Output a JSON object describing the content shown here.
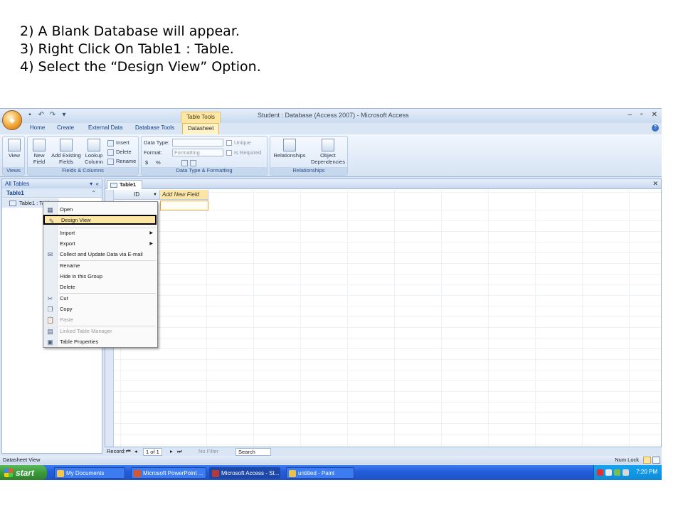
{
  "instructions": [
    "2) A Blank Database will appear.",
    "3) Right Click On Table1 : Table.",
    "4) Select the “Design View” Option."
  ],
  "window": {
    "title": "Student : Database (Access 2007) - Microsoft Access",
    "contextual_tab_group": "Table Tools"
  },
  "ribbon_tabs": [
    "Home",
    "Create",
    "External Data",
    "Database Tools",
    "Datasheet"
  ],
  "active_tab": "Datasheet",
  "ribbon": {
    "views": {
      "view": "View",
      "label": "Views"
    },
    "fields_columns": {
      "new_field": "New Field",
      "add_existing": "Add Existing Fields",
      "lookup": "Lookup Column",
      "insert": "Insert",
      "delete": "Delete",
      "rename": "Rename",
      "label": "Fields & Columns"
    },
    "datatype_formatting": {
      "data_type": "Data Type:",
      "format": "Format:",
      "format_value": "Formatting",
      "currency": "$",
      "percent": "%",
      "unique": "Unique",
      "is_required": "Is Required",
      "label": "Data Type & Formatting"
    },
    "relationships": {
      "relationships": "Relationships",
      "object_dependencies": "Object Dependencies",
      "label": "Relationships"
    }
  },
  "nav_pane": {
    "header": "All Tables",
    "group": "Table1",
    "item": "Table1 : Table"
  },
  "document": {
    "tab": "Table1",
    "columns": [
      "ID",
      "Add New Field"
    ],
    "new_row_marker": "*"
  },
  "record_nav": {
    "label": "Record:",
    "position": "1 of 1",
    "filter": "No Filter",
    "search": "Search"
  },
  "status": {
    "left": "Datasheet View",
    "right": "Num Lock"
  },
  "context_menu": {
    "items": [
      {
        "label": "Open",
        "icon": "open-icon"
      },
      {
        "label": "Design View",
        "icon": "design-view-icon",
        "selected": true
      },
      {
        "label": "Import",
        "submenu": true
      },
      {
        "label": "Export",
        "submenu": true
      },
      {
        "label": "Collect and Update Data via E-mail",
        "icon": "email-icon"
      },
      {
        "label": "Rename"
      },
      {
        "label": "Hide in this Group"
      },
      {
        "label": "Delete"
      },
      {
        "label": "Cut",
        "icon": "scissors-icon"
      },
      {
        "label": "Copy",
        "icon": "copy-icon"
      },
      {
        "label": "Paste",
        "icon": "paste-icon",
        "disabled": true
      },
      {
        "label": "Linked Table Manager",
        "icon": "linked-table-icon",
        "disabled": true
      },
      {
        "label": "Table Properties",
        "icon": "table-properties-icon"
      }
    ]
  },
  "taskbar": {
    "start": "start",
    "tasks": [
      "My Documents",
      "Microsoft PowerPoint ...",
      "Microsoft Access - St...",
      "untitled - Paint"
    ],
    "active_task": "Microsoft Access - St...",
    "clock": "7:20 PM"
  },
  "colors": {
    "ribbon_bg": "#dbe6f4",
    "active_tab": "#fff2c4",
    "highlight": "#fde6a3",
    "taskbar": "#245edb",
    "start_green": "#3a9a3a"
  }
}
